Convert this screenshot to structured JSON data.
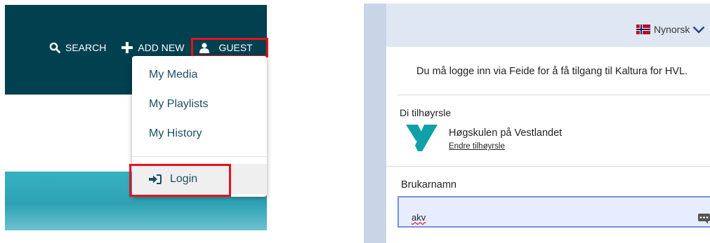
{
  "kaltura": {
    "nav": {
      "search_label": "SEARCH",
      "add_new_label": "ADD NEW",
      "guest_label": "GUEST"
    },
    "menu": {
      "my_media": "My Media",
      "my_playlists": "My Playlists",
      "my_history": "My History",
      "login": "Login"
    },
    "colors": {
      "header_bg": "#01404f",
      "highlight": "#e4121e",
      "menu_text": "#1c4f63",
      "banner": "#35b2c3"
    }
  },
  "feide": {
    "language": "Nynorsk",
    "info_text": "Du må logge inn via Feide for å få tilgang til Kaltura for HVL.",
    "affiliation_label": "Di tilhøyrsle",
    "organization": "Høgskulen på Vestlandet",
    "change_affiliation": "Endre tilhøyrsle",
    "username_label": "Brukarnamn",
    "username_value": "akv",
    "colors": {
      "top_bar": "#dfe7f3",
      "side_bg": "#c8d5e6",
      "logo": "#0fa0a8",
      "field_bg": "#e7ecff"
    }
  }
}
